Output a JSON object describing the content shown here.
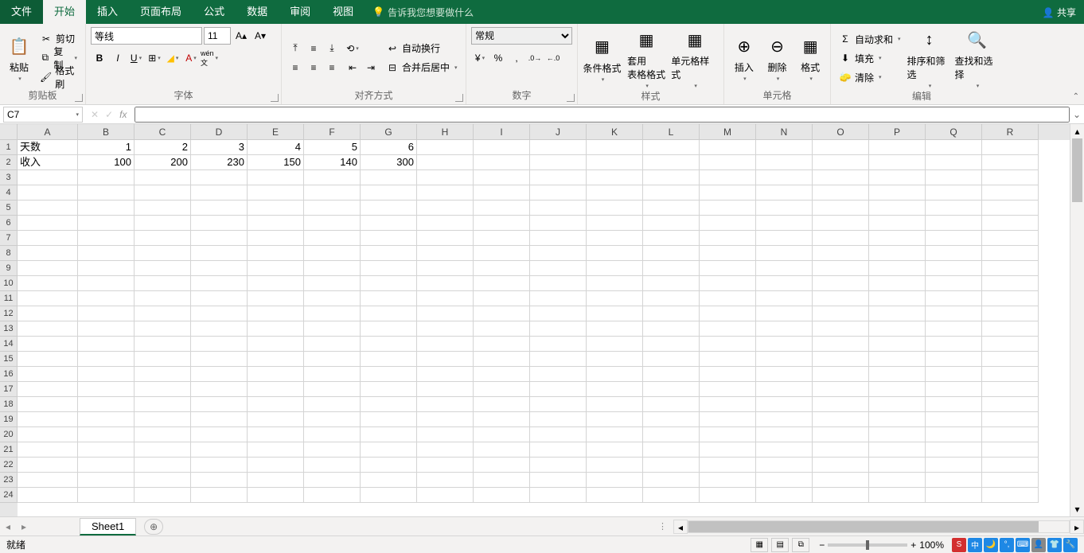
{
  "tabs": {
    "file": "文件",
    "home": "开始",
    "insert": "插入",
    "layout": "页面布局",
    "formulas": "公式",
    "data": "数据",
    "review": "审阅",
    "view": "视图",
    "tellme": "告诉我您想要做什么",
    "share": "共享"
  },
  "ribbon": {
    "clipboard": {
      "paste": "粘贴",
      "cut": "剪切",
      "copy": "复制",
      "painter": "格式刷",
      "label": "剪贴板"
    },
    "font": {
      "name": "等线",
      "size": "11",
      "label": "字体"
    },
    "align": {
      "wrap": "自动换行",
      "merge": "合并后居中",
      "label": "对齐方式"
    },
    "number": {
      "format": "常规",
      "label": "数字"
    },
    "styles": {
      "cond": "条件格式",
      "table": "套用\n表格格式",
      "cell": "单元格样式",
      "label": "样式"
    },
    "cells": {
      "insert": "插入",
      "delete": "删除",
      "format": "格式",
      "label": "单元格"
    },
    "editing": {
      "autosum": "自动求和",
      "fill": "填充",
      "clear": "清除",
      "sort": "排序和筛选",
      "find": "查找和选择",
      "label": "编辑"
    }
  },
  "fx": {
    "namebox": "C7",
    "formula": ""
  },
  "columns": [
    "A",
    "B",
    "C",
    "D",
    "E",
    "F",
    "G",
    "H",
    "I",
    "J",
    "K",
    "L",
    "M",
    "N",
    "O",
    "P",
    "Q",
    "R"
  ],
  "rows": 24,
  "data": {
    "A1": "天数",
    "B1": "1",
    "C1": "2",
    "D1": "3",
    "E1": "4",
    "F1": "5",
    "G1": "6",
    "A2": "收入",
    "B2": "100",
    "C2": "200",
    "D2": "230",
    "E2": "150",
    "F2": "140",
    "G2": "300"
  },
  "numericCols": [
    "B",
    "C",
    "D",
    "E",
    "F",
    "G"
  ],
  "sheet": {
    "name": "Sheet1"
  },
  "status": {
    "ready": "就绪",
    "zoom": "100%"
  }
}
